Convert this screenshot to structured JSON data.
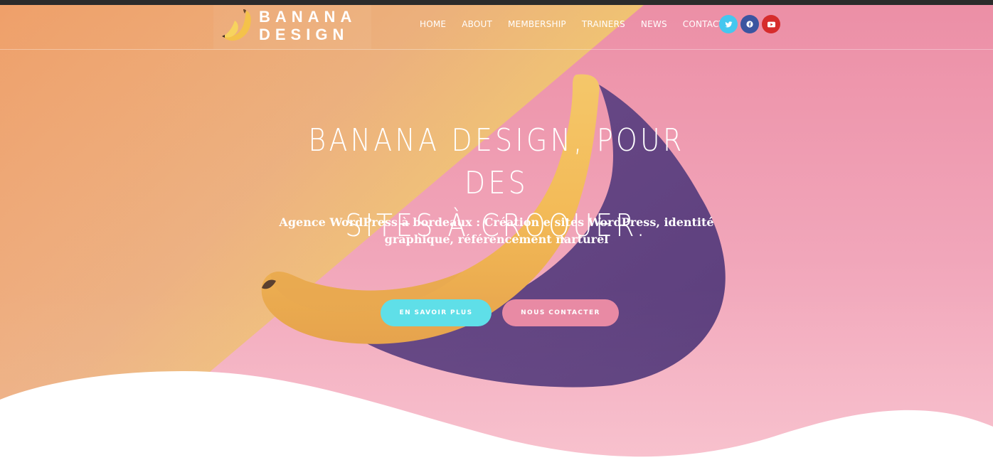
{
  "brand": {
    "line1": "BANANA",
    "line2": "DESIGN"
  },
  "nav": {
    "items": [
      {
        "label": "HOME"
      },
      {
        "label": "ABOUT"
      },
      {
        "label": "MEMBERSHIP"
      },
      {
        "label": "TRAINERS"
      },
      {
        "label": "NEWS"
      },
      {
        "label": "CONTACT"
      }
    ]
  },
  "social": [
    {
      "icon": "twitter-icon",
      "color": "#45c7ef"
    },
    {
      "icon": "facebook-icon",
      "color": "#3b55a0"
    },
    {
      "icon": "youtube-icon",
      "color": "#d62c2c"
    }
  ],
  "hero": {
    "headline_line1": "BANANA DESIGN, POUR DES",
    "headline_line2": "SITES À CROQUER.",
    "subline_line1": "Agence WordPress à bordeaux : Création e sites WordPress, identité",
    "subline_line2": "graphique, référencement narturel",
    "cta_primary": "EN SAVOIR PLUS",
    "cta_secondary": "NOUS CONTACTER"
  },
  "colors": {
    "primary_button": "#5fdfe8",
    "secondary_button": "#e88aa4",
    "pink": "#f0a2b8",
    "orange": "#eca775",
    "yellow": "#f5e06a"
  }
}
